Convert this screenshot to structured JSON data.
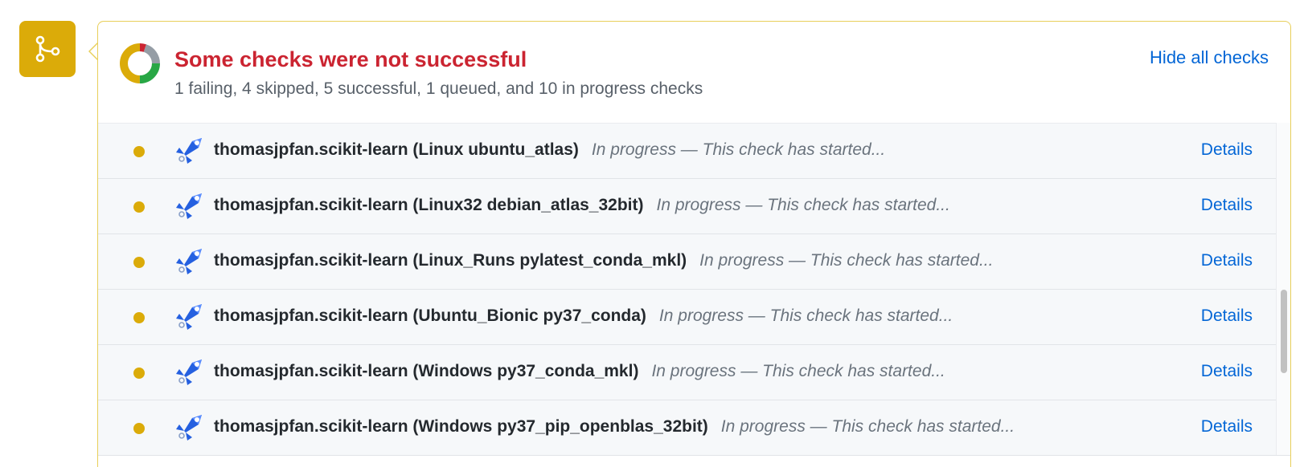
{
  "merge_badge": {
    "icon": "git-merge-icon",
    "color": "#dbab09"
  },
  "status": {
    "title": "Some checks were not successful",
    "summary": "1 failing, 4 skipped, 5 successful, 1 queued, and 10 in progress checks",
    "hide_label": "Hide all checks",
    "colors": {
      "failing": "#cb2431",
      "skipped": "#959da5",
      "successful": "#28a745",
      "in_progress": "#dbab09",
      "link": "#0366d6"
    }
  },
  "checks": [
    {
      "name": "thomasjpfan.scikit-learn (Linux ubuntu_atlas)",
      "description": "In progress — This check has started...",
      "details": "Details",
      "state": "in_progress",
      "icon": "azure-pipelines-icon"
    },
    {
      "name": "thomasjpfan.scikit-learn (Linux32 debian_atlas_32bit)",
      "description": "In progress — This check has started...",
      "details": "Details",
      "state": "in_progress",
      "icon": "azure-pipelines-icon"
    },
    {
      "name": "thomasjpfan.scikit-learn (Linux_Runs pylatest_conda_mkl)",
      "description": "In progress — This check has started...",
      "details": "Details",
      "state": "in_progress",
      "icon": "azure-pipelines-icon"
    },
    {
      "name": "thomasjpfan.scikit-learn (Ubuntu_Bionic py37_conda)",
      "description": "In progress — This check has started...",
      "details": "Details",
      "state": "in_progress",
      "icon": "azure-pipelines-icon"
    },
    {
      "name": "thomasjpfan.scikit-learn (Windows py37_conda_mkl)",
      "description": "In progress — This check has started...",
      "details": "Details",
      "state": "in_progress",
      "icon": "azure-pipelines-icon"
    },
    {
      "name": "thomasjpfan.scikit-learn (Windows py37_pip_openblas_32bit)",
      "description": "In progress — This check has started...",
      "details": "Details",
      "state": "in_progress",
      "icon": "azure-pipelines-icon"
    }
  ]
}
